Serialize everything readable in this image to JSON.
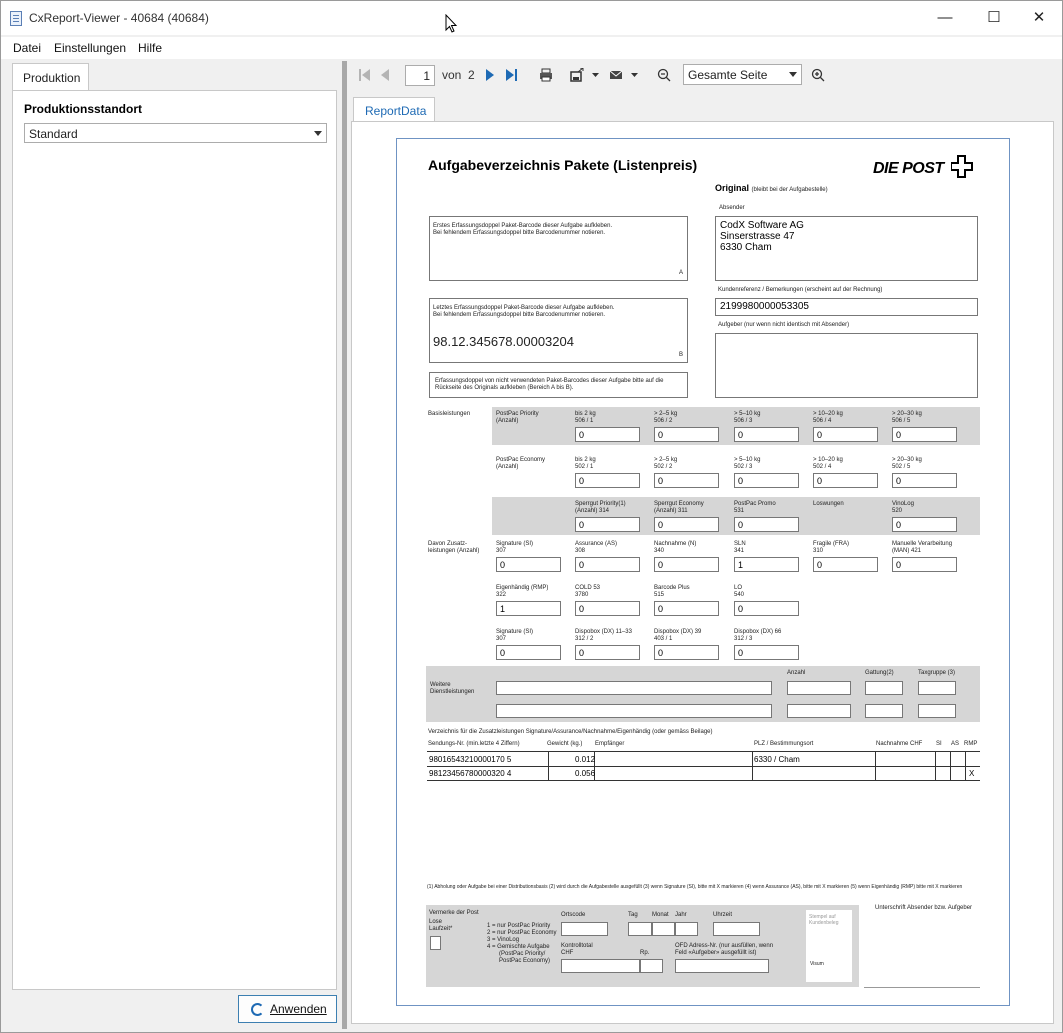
{
  "window": {
    "title": "CxReport-Viewer - 40684 (40684)",
    "minimize": "—",
    "maximize": "☐",
    "close": "✕"
  },
  "menu": {
    "file": "Datei",
    "settings": "Einstellungen",
    "help": "Hilfe"
  },
  "left": {
    "tab": "Produktion",
    "field_label": "Produktionsstandort",
    "field_value": "Standard",
    "apply_button": "Anwenden"
  },
  "toolbar": {
    "page": "1",
    "of_label": "von",
    "total_pages": "2",
    "zoom": "Gesamte Seite"
  },
  "report_tab": "ReportData",
  "colors": {
    "accent": "#1e6ab4",
    "grey_band": "#d6d6d6",
    "frame_border": "#6f93c3"
  },
  "form": {
    "title": "Aufgabeverzeichnis Pakete (Listenpreis)",
    "logo": "DIE POST",
    "original": "Original",
    "original_note": "(bleibt bei der Aufgabestelle)",
    "absender_label": "Absender",
    "absender_lines": [
      "CodX Software AG",
      "Sinserstrasse 47",
      "6330 Cham"
    ],
    "box_a_text": [
      "Erstes Erfassungsdoppel Paket-Barcode dieser Aufgabe aufkleben.",
      "Bei fehlendem Erfassungsdoppel bitte Barcodenummer notieren."
    ],
    "box_a_letter": "A",
    "box_b_text": [
      "Letztes Erfassungsdoppel Paket-Barcode dieser Aufgabe aufkleben.",
      "Bei fehlendem Erfassungsdoppel bitte Barcodenummer notieren."
    ],
    "box_b_number": "98.12.345678.00003204",
    "box_b_letter": "B",
    "rueckseite_text": [
      "Erfassungsdoppel von nicht verwendeten Paket-Barcodes dieser Aufgabe bitte auf die",
      "Rückseite des Originals aufkleben (Bereich A bis B)."
    ],
    "kundenref_label": "Kundenreferenz / Bemerkungen (erscheint auf der Rechnung)",
    "kundenref_value": "2199980000053305",
    "aufgeber_label": "Aufgeber (nur wenn nicht identisch mit Absender)",
    "basis_label": "Basisleistungen",
    "priority_label": [
      "PostPac Priority",
      "(Anzahl)"
    ],
    "priority": [
      {
        "h": "bis 2 kg",
        "c": "506 / 1",
        "v": "0"
      },
      {
        "h": "> 2–5 kg",
        "c": "506 / 2",
        "v": "0"
      },
      {
        "h": "> 5–10 kg",
        "c": "506 / 3",
        "v": "0"
      },
      {
        "h": "> 10–20 kg",
        "c": "506 / 4",
        "v": "0"
      },
      {
        "h": "> 20–30 kg",
        "c": "506 / 5",
        "v": "0"
      }
    ],
    "economy_label": [
      "PostPac Economy",
      "(Anzahl)"
    ],
    "economy": [
      {
        "h": "bis 2 kg",
        "c": "502 / 1",
        "v": "0"
      },
      {
        "h": "> 2–5 kg",
        "c": "502 / 2",
        "v": "0"
      },
      {
        "h": "> 5–10 kg",
        "c": "502 / 3",
        "v": "0"
      },
      {
        "h": "> 10–20 kg",
        "c": "502 / 4",
        "v": "0"
      },
      {
        "h": "> 20–30 kg",
        "c": "502 / 5",
        "v": "0"
      }
    ],
    "row3": [
      {
        "h": "Sperrgut Priority(1)",
        "c": "(Anzahl) 314",
        "v": "0"
      },
      {
        "h": "Sperrgut Economy",
        "c": "(Anzahl) 311",
        "v": "0"
      },
      {
        "h": "PostPac Promo",
        "c": "531",
        "v": "0"
      },
      {
        "h": "Loswungen",
        "c": "",
        "v": ""
      },
      {
        "h": "VinoLog",
        "c": "520",
        "v": "0"
      }
    ],
    "zusatz_label": [
      "Davon Zusatz-",
      "leistungen (Anzahl)"
    ],
    "row4": [
      {
        "h": "Signature (SI)",
        "c": "307",
        "v": "0"
      },
      {
        "h": "Assurance (AS)",
        "c": "308",
        "v": "0"
      },
      {
        "h": "Nachnahme (N)",
        "c": "340",
        "v": "0"
      },
      {
        "h": "SLN",
        "c": "341",
        "v": "1"
      },
      {
        "h": "Fragile (FRA)",
        "c": "310",
        "v": "0"
      },
      {
        "h": "Manuelle Verarbeitung",
        "c": "(MAN) 421",
        "v": "0"
      }
    ],
    "row5": [
      {
        "h": "Eigenhändig (RMP)",
        "c": "322",
        "v": "1"
      },
      {
        "h": "COLD 53",
        "c": "3780",
        "v": "0"
      },
      {
        "h": "Barcode Plus",
        "c": "515",
        "v": "0"
      },
      {
        "h": "LO",
        "c": "540",
        "v": "0"
      }
    ],
    "row6": [
      {
        "h": "Signature (SI)",
        "c": "307",
        "v": "0"
      },
      {
        "h": "Dispobox (DX) 11–33",
        "c": "312 / 2",
        "v": "0"
      },
      {
        "h": "Dispobox (DX) 39",
        "c": "403 / 1",
        "v": "0"
      },
      {
        "h": "Dispobox (DX) 66",
        "c": "312 / 3",
        "v": "0"
      }
    ],
    "weitere_label": [
      "Weitere",
      "Dienstleistungen"
    ],
    "weitere_cols": [
      "Anzahl",
      "Gattung(2)",
      "Taxgruppe (3)"
    ],
    "verzeichnis_title": "Verzeichnis für die Zusatzleistungen Signature/Assurance/Nachnahme/Eigenhändig (oder gemäss Beilage)",
    "table_headers": [
      "Sendungs-Nr. (min.letzte 4 Ziffern)",
      "Gewicht (kg.)",
      "Empfänger",
      "PLZ / Bestimmungsort",
      "Nachnahme CHF",
      "SI",
      "AS",
      "RMP"
    ],
    "table_rows": [
      [
        "98016543210000170 5",
        "0.012",
        "",
        "6330 / Cham",
        "",
        "",
        "",
        ""
      ],
      [
        "98123456780000320 4",
        "0.056",
        "",
        "",
        "",
        "",
        "",
        "X"
      ]
    ],
    "footnotes": "(1) Abholung oder Aufgabe bei einer Distributionsbasis   (2) wird durch die Aufgabestelle ausgefüllt   (3) wenn Signature (SI), bitte mit X markieren   (4) wenn Assurance (AS), bitte mit X markieren   (5) wenn Eigenhändig (RMP) bitte mit X markieren",
    "vermerke_label": "Vermerke der Post",
    "lose_label": [
      "Lose",
      "Laufzeit*"
    ],
    "legend": [
      "1 = nur PostPac Priority",
      "2 = nur PostPac Economy",
      "3 = VinoLog",
      "4 = Gemischte Aufgabe",
      "(PostPac Priority/",
      "PostPac Economy)"
    ],
    "datum_fields": [
      "Ortscode",
      "Tag",
      "Monat",
      "Jahr",
      "Uhrzeit"
    ],
    "kontrolltotal": [
      "Kontrolltotal",
      "CHF"
    ],
    "rp_label": "Rp.",
    "ofd_label": [
      "OFD Adress-Nr. (nur ausfüllen, wenn",
      "Feld «Aufgeber» ausgefüllt ist)"
    ],
    "stempel": [
      "Stempel auf",
      "Kundenbeleg"
    ],
    "visum": "Visum",
    "unterschrift": "Unterschrift Absender bzw. Aufgeber"
  }
}
